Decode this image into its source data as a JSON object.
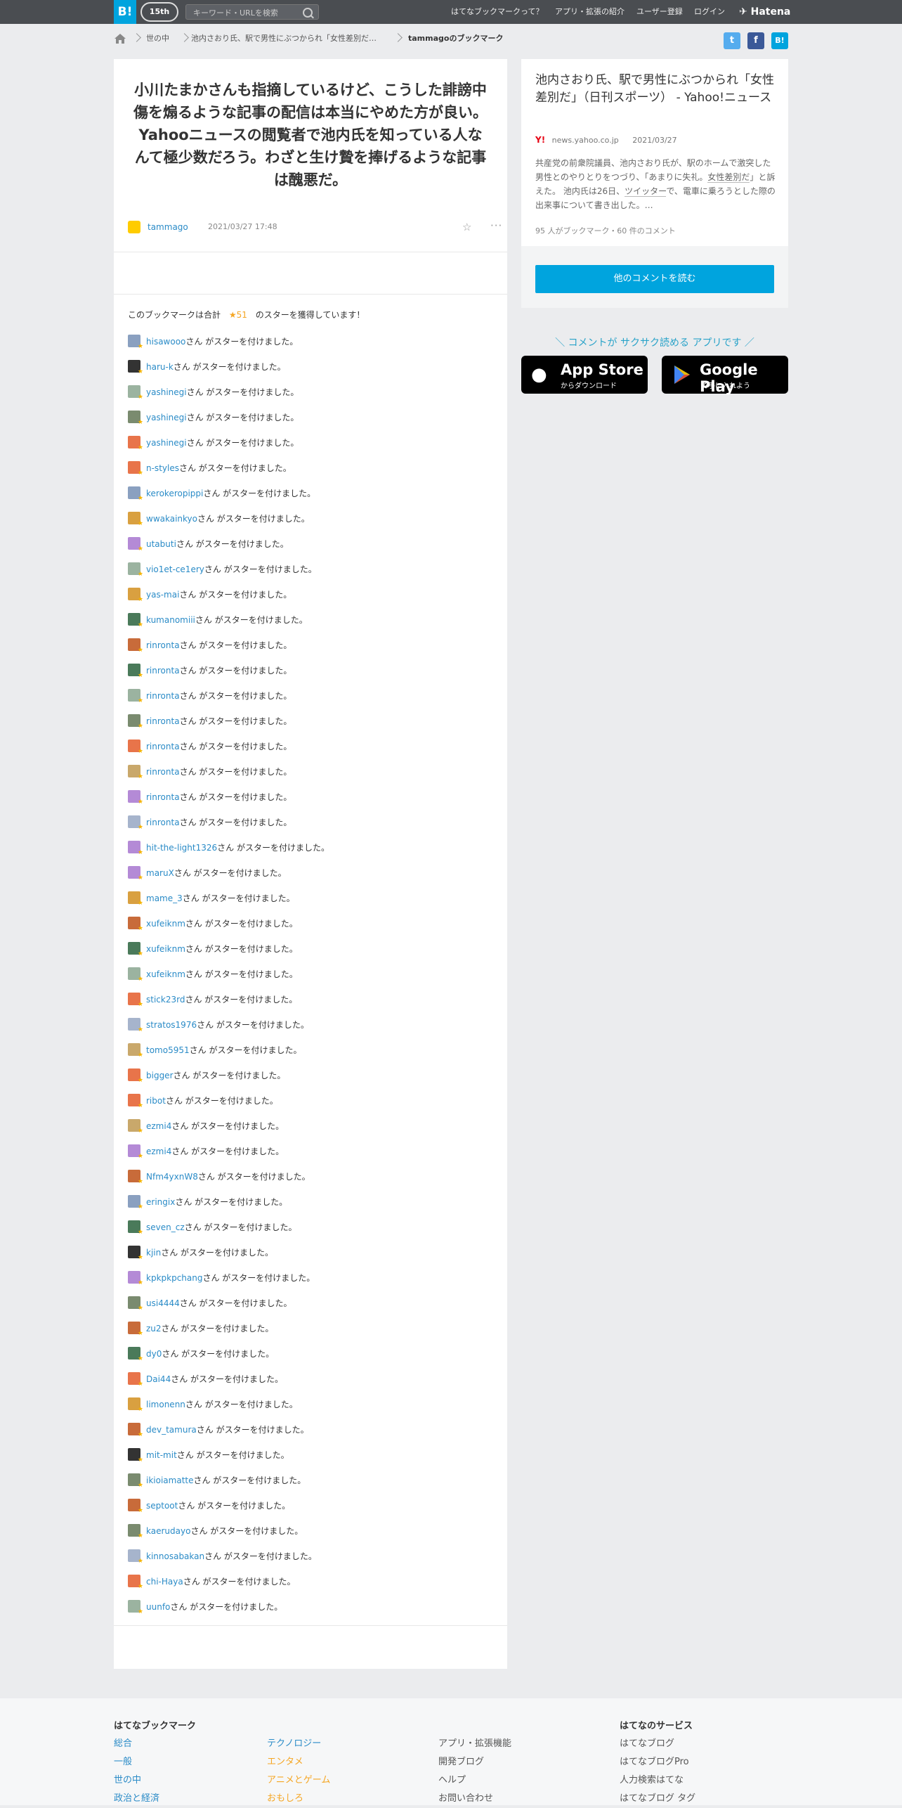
{
  "header": {
    "logo": "B!",
    "anniversary": "15th",
    "search_placeholder": "キーワード・URLを検索",
    "nav": [
      "はてなブックマークって？",
      "アプリ・拡張の紹介",
      "ユーザー登録",
      "ログイン"
    ],
    "brand": "Hatena"
  },
  "breadcrumb": [
    "世の中",
    "池内さおり氏、駅で男性にぶつかられ「女性差別だ…",
    "tammagoのブックマーク"
  ],
  "share": [
    "t",
    "f",
    "B!"
  ],
  "bookmark": {
    "comment": "小川たまかさんも指摘しているけど、こうした誹謗中傷を煽るような記事の配信は本当にやめた方が良い。Yahooニュースの閲覧者で池内氏を知っている人なんて極少数だろう。わざと生け贄を捧げるような記事は醜悪だ。",
    "author": "tammago",
    "date": "2021/03/27 17:48",
    "star_summary_pre": "このブックマークは合計",
    "star_count": "★51",
    "star_summary_post": "のスターを獲得しています！",
    "star_suffix": "さん がスターを付けました。",
    "stargazers": [
      "hisawooo",
      "haru-k",
      "yashinegi",
      "yashinegi",
      "yashinegi",
      "n-styles",
      "kerokeropippi",
      "wwakainkyo",
      "utabuti",
      "vio1et-ce1ery",
      "yas-mai",
      "kumanomiii",
      "rinronta",
      "rinronta",
      "rinronta",
      "rinronta",
      "rinronta",
      "rinronta",
      "rinronta",
      "rinronta",
      "hit-the-light1326",
      "maruX",
      "mame_3",
      "xufeiknm",
      "xufeiknm",
      "xufeiknm",
      "stick23rd",
      "stratos1976",
      "tomo5951",
      "bigger",
      "ribot",
      "ezmi4",
      "ezmi4",
      "Nfm4yxnW8",
      "eringix",
      "seven_cz",
      "kjin",
      "kpkpkpchang",
      "usi4444",
      "zu2",
      "dy0",
      "Dai44",
      "limonenn",
      "dev_tamura",
      "mit-mit",
      "ikioiamatte",
      "septoot",
      "kaerudayo",
      "kinnosabakan",
      "chi-Haya",
      "uunfo"
    ]
  },
  "entry": {
    "title": "池内さおり氏、駅で男性にぶつかられ「女性差別だ」（日刊スポーツ） - Yahoo!ニュース",
    "site_icon": "Y!",
    "domain": "news.yahoo.co.jp",
    "date": "2021/03/27",
    "desc_1": "共産党の前衆院議員、池内さおり氏が、駅のホームで激突した男性とのやりとりをつづり、「あまりに失礼。",
    "desc_u": "女性差別だ",
    "desc_2": "」と訴えた。 池内氏は26日、",
    "desc_u2": "ツイッター",
    "desc_3": "で、電車に乗ろうとした際の出来事について書き出した。…",
    "meta": "95 人がブックマーク・60 件のコメント",
    "read_button": "他のコメントを読む"
  },
  "promo": {
    "text": "＼ コメントが サクサク読める アプリです ／",
    "appstore_big": "App Store",
    "appstore_small": "からダウンロード",
    "gplay_big": "Google Play",
    "gplay_small": "で手に入れよう"
  },
  "footer": {
    "col1_title": "はてなブックマーク",
    "col1": [
      "総合",
      "一般",
      "世の中",
      "政治と経済"
    ],
    "col2": [
      "テクノロジー",
      "エンタメ",
      "アニメとゲーム",
      "おもしろ"
    ],
    "col3": [
      "アプリ・拡張機能",
      "開発ブログ",
      "ヘルプ",
      "お問い合わせ"
    ],
    "col4_title": "はてなのサービス",
    "col4": [
      "はてなブログ",
      "はてなブログPro",
      "人力検索はてな",
      "はてなブログ タグ"
    ]
  },
  "colors": {
    "accent": "#00a4de",
    "link": "#2a8bc7",
    "star": "#f5a623",
    "header": "#4a4d51"
  }
}
